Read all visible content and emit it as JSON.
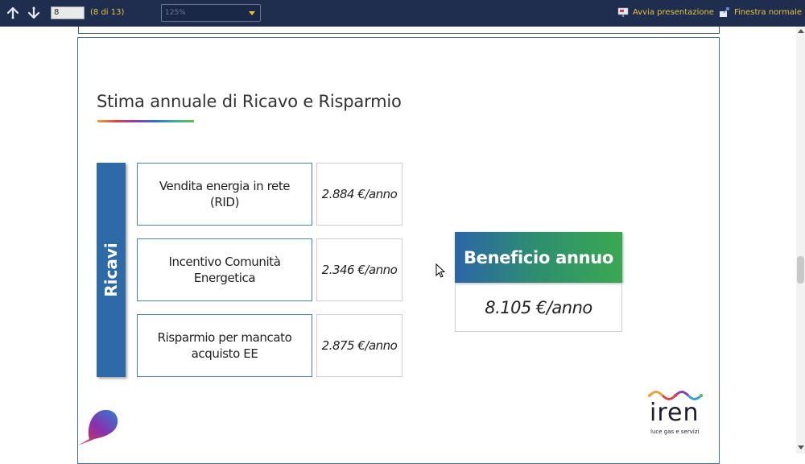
{
  "toolbar": {
    "page_input_value": "8",
    "page_count": "(8 di 13)",
    "zoom_value": "125%",
    "start_presentation_label": "Avvia presentazione",
    "normal_window_label": "Finestra normale"
  },
  "slide": {
    "title": "Stima annuale di Ricavo e Risparmio",
    "side_label": "Ricavi",
    "items": [
      {
        "label": "Vendita energia in rete (RID)",
        "value": "2.884 €/anno"
      },
      {
        "label": "Incentivo Comunità Energetica",
        "value": "2.346 €/anno"
      },
      {
        "label": "Risparmio per mancato acquisto EE",
        "value": "2.875 €/anno"
      }
    ],
    "benefit_title": "Beneficio annuo",
    "benefit_value": "8.105 €/anno",
    "logo_text": "iren",
    "logo_tagline": "luce gas e servizi"
  },
  "colors": {
    "toolbar_bg": "#1f2d4f",
    "accent_yellow": "#e8c23a",
    "ricavi_blue": "#2e6aa8",
    "benefit_gradient_start": "#2b66a8",
    "benefit_gradient_end": "#3aa852"
  }
}
